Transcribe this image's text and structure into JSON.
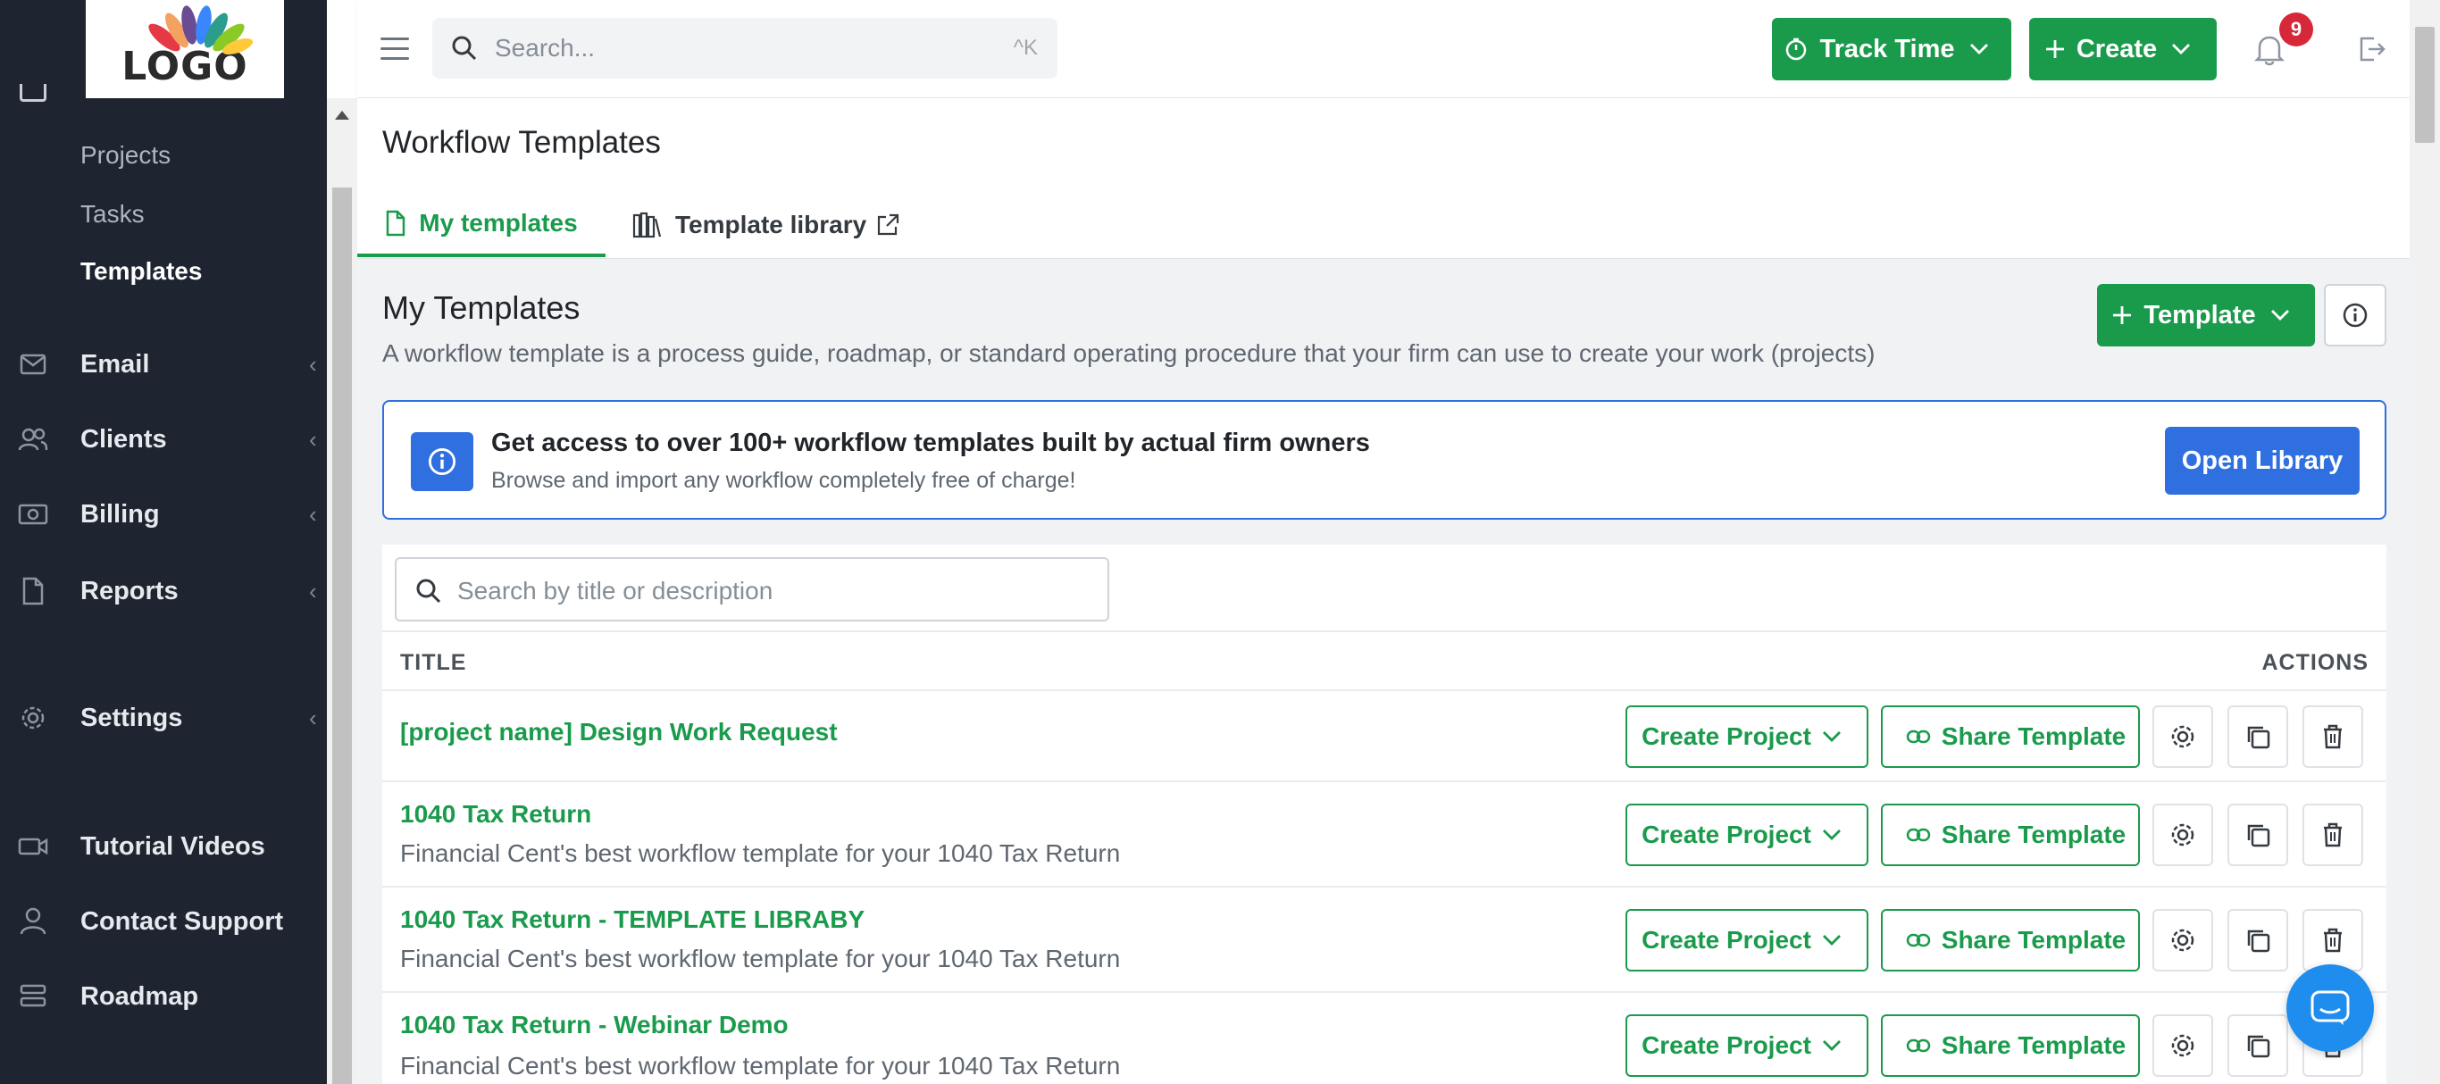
{
  "logo": {
    "text": "LOGO"
  },
  "sidebar": {
    "sub_items": [
      {
        "label": "Projects"
      },
      {
        "label": "Tasks"
      },
      {
        "label": "Templates"
      }
    ],
    "items": [
      {
        "label": "Email",
        "icon": "mail-icon"
      },
      {
        "label": "Clients",
        "icon": "users-icon"
      },
      {
        "label": "Billing",
        "icon": "money-icon"
      },
      {
        "label": "Reports",
        "icon": "file-icon"
      },
      {
        "label": "Settings",
        "icon": "gear-icon"
      },
      {
        "label": "Tutorial Videos",
        "icon": "video-icon"
      },
      {
        "label": "Contact Support",
        "icon": "person-icon"
      },
      {
        "label": "Roadmap",
        "icon": "roadmap-icon"
      }
    ]
  },
  "topbar": {
    "search_placeholder": "Search...",
    "search_shortcut": "^K",
    "track_time_label": "Track Time",
    "create_label": "Create",
    "notification_count": "9"
  },
  "page": {
    "title": "Workflow Templates",
    "tabs": [
      {
        "label": "My templates"
      },
      {
        "label": "Template library"
      }
    ]
  },
  "section": {
    "title": "My Templates",
    "description": "A workflow template is a process guide, roadmap, or standard operating procedure that your firm can use to create your work (projects)",
    "template_button": "Template"
  },
  "promo": {
    "heading": "Get access to over 100+ workflow templates built by actual firm owners",
    "subtext": "Browse and import any workflow completely free of charge!",
    "button": "Open Library"
  },
  "table": {
    "search_placeholder": "Search by title or description",
    "col_title": "TITLE",
    "col_actions": "ACTIONS",
    "create_project_label": "Create Project",
    "share_template_label": "Share Template",
    "rows": [
      {
        "title": "[project name] Design Work Request",
        "description": ""
      },
      {
        "title": "1040 Tax Return",
        "description": "Financial Cent's best workflow template for your 1040 Tax Return"
      },
      {
        "title": "1040 Tax Return - TEMPLATE LIBRABY",
        "description": "Financial Cent's best workflow template for your 1040 Tax Return"
      },
      {
        "title": "1040 Tax Return - Webinar Demo",
        "description": "Financial Cent's best workflow template for your 1040 Tax Return"
      }
    ]
  },
  "colors": {
    "brand_green": "#1a9b4c",
    "accent_blue": "#2f6fdf",
    "sidebar_bg": "#1e2530",
    "badge_red": "#d62839"
  }
}
